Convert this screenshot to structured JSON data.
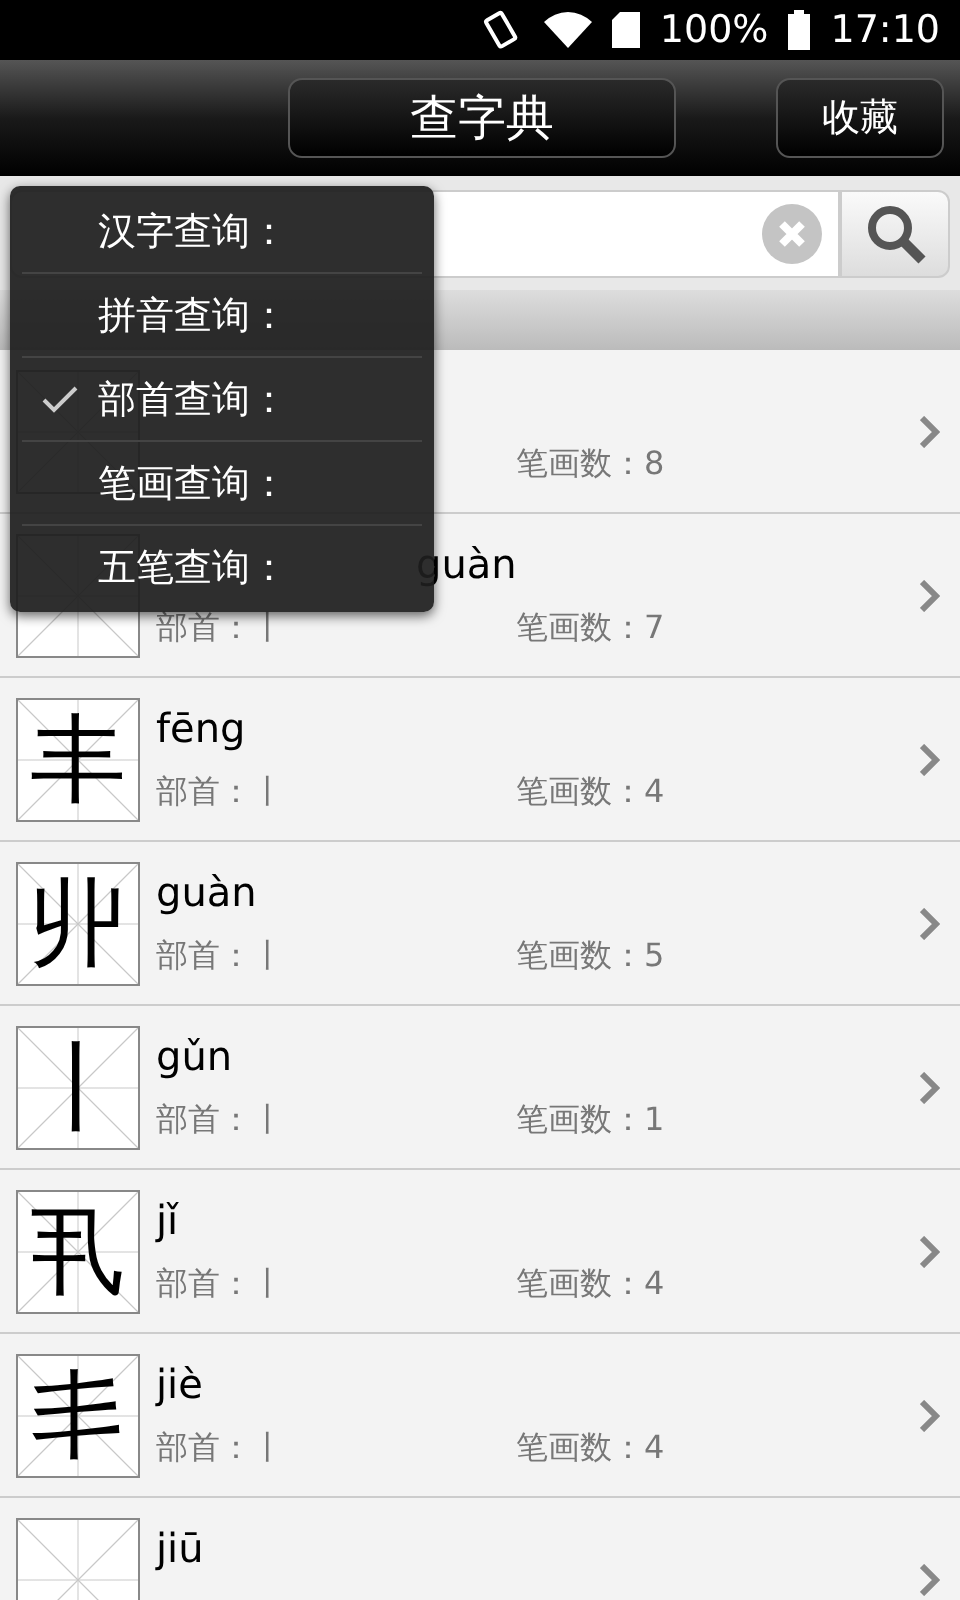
{
  "status_bar": {
    "battery": "100%",
    "time": "17:10"
  },
  "header": {
    "title": "查字典",
    "favorites": "收藏"
  },
  "menu": [
    {
      "label": "汉字查询：",
      "selected": false
    },
    {
      "label": "拼音查询：",
      "selected": false
    },
    {
      "label": "部首查询：",
      "selected": true
    },
    {
      "label": "笔画查询：",
      "selected": false
    },
    {
      "label": "五笔查询：",
      "selected": false
    }
  ],
  "rows": [
    {
      "strokes": "笔画数：8"
    },
    {
      "pinyin": "guàn",
      "radical": "部首：丨",
      "strokes": "笔画数：7"
    },
    {
      "char": "丰",
      "pinyin": "fēng",
      "radical": "部首：丨",
      "strokes": "笔画数：4"
    },
    {
      "char": "丱",
      "pinyin": "guàn",
      "radical": "部首：丨",
      "strokes": "笔画数：5"
    },
    {
      "char": "丨",
      "pinyin": "gǔn",
      "radical": "部首：丨",
      "strokes": "笔画数：1"
    },
    {
      "char": "丮",
      "pinyin": "jǐ",
      "radical": "部首：丨",
      "strokes": "笔画数：4"
    },
    {
      "char": "丯",
      "pinyin": "jiè",
      "radical": "部首：丨",
      "strokes": "笔画数：4"
    },
    {
      "pinyin": "jiū"
    }
  ]
}
